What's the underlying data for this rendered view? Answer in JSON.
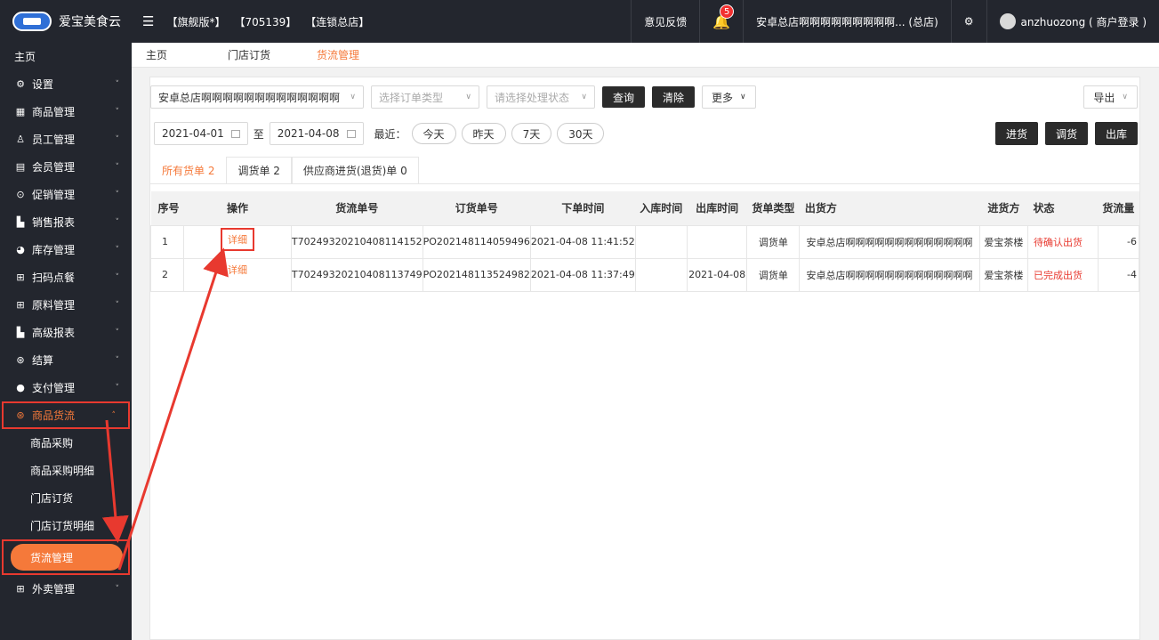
{
  "header": {
    "app_name": "爱宝美食云",
    "edition": "【旗舰版*】",
    "shop_id": "【705139】",
    "store_type": "【连锁总店】",
    "feedback": "意见反馈",
    "notification_count": "5",
    "store_name": "安卓总店啊啊啊啊啊啊啊啊啊... (总店)",
    "user": "anzhuozong ( 商户登录 )"
  },
  "sidebar": {
    "home": "主页",
    "items": [
      {
        "label": "设置",
        "icon": "gear-icon"
      },
      {
        "label": "商品管理",
        "icon": "goods-icon"
      },
      {
        "label": "员工管理",
        "icon": "staff-icon"
      },
      {
        "label": "会员管理",
        "icon": "member-icon"
      },
      {
        "label": "促销管理",
        "icon": "promo-icon"
      },
      {
        "label": "销售报表",
        "icon": "chart-icon"
      },
      {
        "label": "库存管理",
        "icon": "stock-icon"
      },
      {
        "label": "扫码点餐",
        "icon": "scan-icon"
      },
      {
        "label": "原料管理",
        "icon": "material-icon"
      },
      {
        "label": "高级报表",
        "icon": "chart-icon"
      },
      {
        "label": "结算",
        "icon": "settle-icon"
      },
      {
        "label": "支付管理",
        "icon": "pay-icon"
      }
    ],
    "active_group": "商品货流",
    "sub_items": [
      "商品采购",
      "商品采购明细",
      "门店订货",
      "门店订货明细"
    ],
    "active_sub": "货流管理",
    "after": "外卖管理"
  },
  "tabs": [
    "主页",
    "门店订货",
    "货流管理"
  ],
  "filters": {
    "store": "安卓总店啊啊啊啊啊啊啊啊啊啊啊啊啊",
    "order_type_placeholder": "选择订单类型",
    "status_placeholder": "请选择处理状态",
    "query": "查询",
    "clear": "清除",
    "more": "更多",
    "export": "导出",
    "date_from": "2021-04-01",
    "to": "至",
    "date_to": "2021-04-08",
    "recent": "最近：",
    "quick": [
      "今天",
      "昨天",
      "7天",
      "30天"
    ],
    "actions": [
      "进货",
      "调货",
      "出库"
    ]
  },
  "subtabs": [
    "所有货单 2",
    "调货单 2",
    "供应商进货(退货)单 0"
  ],
  "table": {
    "headers": [
      "序号",
      "操作",
      "货流单号",
      "订货单号",
      "下单时间",
      "入库时间",
      "出库时间",
      "货单类型",
      "出货方",
      "进货方",
      "状态",
      "货流量"
    ],
    "rows": [
      {
        "no": "1",
        "op": "详细",
        "flow_no": "T70249320210408114152",
        "order_no": "PO202148114059496",
        "order_time": "2021-04-08 11:41:52",
        "in_time": "",
        "out_time": "",
        "type": "调货单",
        "from": "安卓总店啊啊啊啊啊啊啊啊啊啊啊啊啊",
        "to": "爱宝茶楼",
        "status": "待确认出货",
        "qty": "-6"
      },
      {
        "no": "2",
        "op": "详细",
        "flow_no": "T70249320210408113749",
        "order_no": "PO202148113524982",
        "order_time": "2021-04-08 11:37:49",
        "in_time": "",
        "out_time": "2021-04-08",
        "type": "调货单",
        "from": "安卓总店啊啊啊啊啊啊啊啊啊啊啊啊啊",
        "to": "爱宝茶楼",
        "status": "已完成出货",
        "qty": "-4"
      }
    ]
  },
  "colors": {
    "accent": "#f5793a",
    "annotation": "#e8392f",
    "dark": "#23262e"
  }
}
